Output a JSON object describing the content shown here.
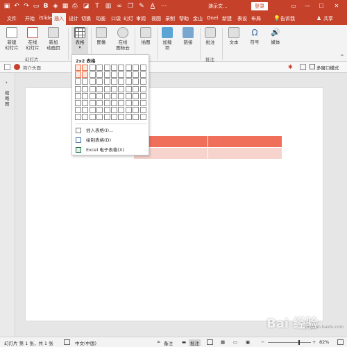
{
  "quick_access": [
    "save-icon",
    "undo-icon",
    "redo-icon",
    "present-icon",
    "bold-icon",
    "font-color-icon",
    "more-icon"
  ],
  "title": {
    "doc_name": "演示文...",
    "login": "登录"
  },
  "tabs": [
    "文件",
    "开始",
    "iSlide",
    "插入",
    "设计",
    "切换",
    "动画",
    "口袋",
    "幻灯",
    "审阅",
    "视图",
    "录制",
    "帮助",
    "金山",
    "Onel",
    "新建",
    "表设",
    "布局"
  ],
  "active_tab": "插入",
  "tell_me": "告诉我",
  "share": "共享",
  "ribbon": {
    "buttons": [
      "新建\n幻灯片",
      "在线\n幻灯片",
      "新加\n动画页",
      "表格",
      "图像",
      "在线\n图标云",
      "插图",
      "加载\n项",
      "链接",
      "批注",
      "文本",
      "符号",
      "媒体"
    ],
    "groups": [
      "幻灯片",
      "批注"
    ]
  },
  "format_bar": {
    "font_box": "简介头面",
    "multi_window": "多窗口模式"
  },
  "left_panel": {
    "outline_label": "缩略图"
  },
  "dropdown": {
    "grid_label": "2x2 表格",
    "grid_cols": 10,
    "grid_rows": 8,
    "selected_cols": 2,
    "selected_rows": 2,
    "items": [
      {
        "icon": "insert-table-icon",
        "label": "插入表格(I)..."
      },
      {
        "icon": "draw-table-icon",
        "label": "绘制表格(D)"
      },
      {
        "icon": "excel-icon",
        "label": "Excel 电子表格(X)"
      }
    ]
  },
  "slide_table": {
    "rows": 2,
    "cols": 2,
    "header_color": "#ef6f5b",
    "body_color": "#f7d3cd"
  },
  "status": {
    "slide_info": "幻灯片 第 1 张，共 1 张",
    "language": "中文(中国)",
    "notes": "备注",
    "comments": "批注",
    "zoom": "82%"
  },
  "watermark": {
    "text": "Bai 经验",
    "sub": "jingyan.baidu.com"
  },
  "colors": {
    "accent": "#c5412a",
    "ribbon_bg": "#f3f3f3"
  }
}
